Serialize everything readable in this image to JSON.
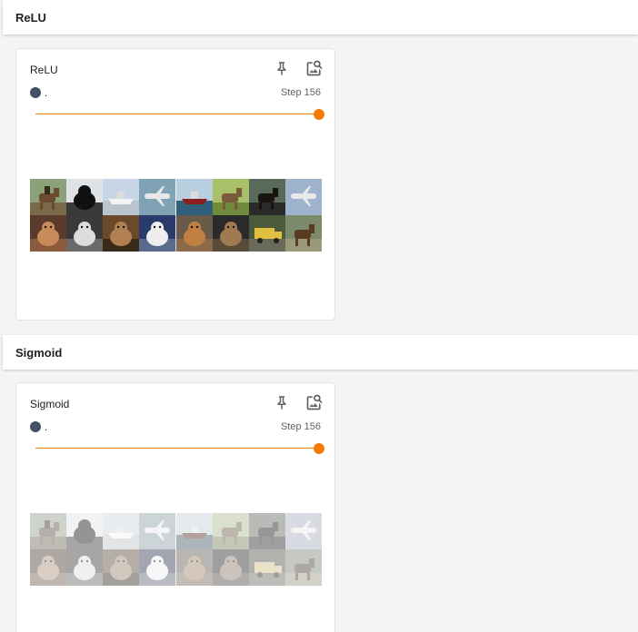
{
  "sections": [
    {
      "header": "ReLU",
      "card": {
        "title": "ReLU",
        "run_label": ".",
        "step": "Step 156",
        "step_fraction": 1.0,
        "faded": false
      }
    },
    {
      "header": "Sigmoid",
      "card": {
        "title": "Sigmoid",
        "run_label": ".",
        "step": "Step 156",
        "step_fraction": 1.0,
        "faded": true
      }
    }
  ],
  "colors": {
    "accent": "#f57c00",
    "run_dot": "#425066"
  },
  "icons": {
    "pin": "pin-icon",
    "image_search": "image-search-icon"
  },
  "image_grid": {
    "rows": 2,
    "cols": 8,
    "thumbnails": [
      {
        "subject": "horse-rider",
        "sky": "#8aa17a",
        "ground": "#7a6a4a",
        "fg": "#6b4a2e"
      },
      {
        "subject": "dog",
        "sky": "#dfe3e6",
        "ground": "#3a3a3a",
        "fg": "#111111"
      },
      {
        "subject": "ship",
        "sky": "#c7d6e6",
        "ground": "#b9c4cf",
        "fg": "#f4f4f4"
      },
      {
        "subject": "airplane",
        "sky": "#7fa3b5",
        "ground": "#5f7f8f",
        "fg": "#e8e8e8"
      },
      {
        "subject": "ship",
        "sky": "#b9cfe0",
        "ground": "#2f5f7a",
        "fg": "#8a1f1f"
      },
      {
        "subject": "deer",
        "sky": "#a9c06a",
        "ground": "#6e8a3a",
        "fg": "#7a5a3a"
      },
      {
        "subject": "horse",
        "sky": "#5a6a5a",
        "ground": "#2a2a2a",
        "fg": "#1a1410"
      },
      {
        "subject": "airplane",
        "sky": "#9fb3cf",
        "ground": "#6f7f6f",
        "fg": "#e9e9e9"
      },
      {
        "subject": "cat",
        "sky": "#5a3a2a",
        "ground": "#8a5a3a",
        "fg": "#c98a5a"
      },
      {
        "subject": "cat",
        "sky": "#3a3a3a",
        "ground": "#6a6a6a",
        "fg": "#dcdcdc"
      },
      {
        "subject": "cat",
        "sky": "#6a4a2a",
        "ground": "#3a2a1a",
        "fg": "#b08050"
      },
      {
        "subject": "dog",
        "sky": "#2a3a6a",
        "ground": "#5a6a8a",
        "fg": "#eeeeee"
      },
      {
        "subject": "dog",
        "sky": "#6a5a4a",
        "ground": "#8a6a4a",
        "fg": "#c08040"
      },
      {
        "subject": "dog",
        "sky": "#2a2a2a",
        "ground": "#5a4a3a",
        "fg": "#a07a50"
      },
      {
        "subject": "truck",
        "sky": "#4a5a3a",
        "ground": "#6a6a5a",
        "fg": "#e0c040"
      },
      {
        "subject": "horse",
        "sky": "#7a8a6a",
        "ground": "#9a9a7a",
        "fg": "#5a3a20"
      }
    ]
  }
}
